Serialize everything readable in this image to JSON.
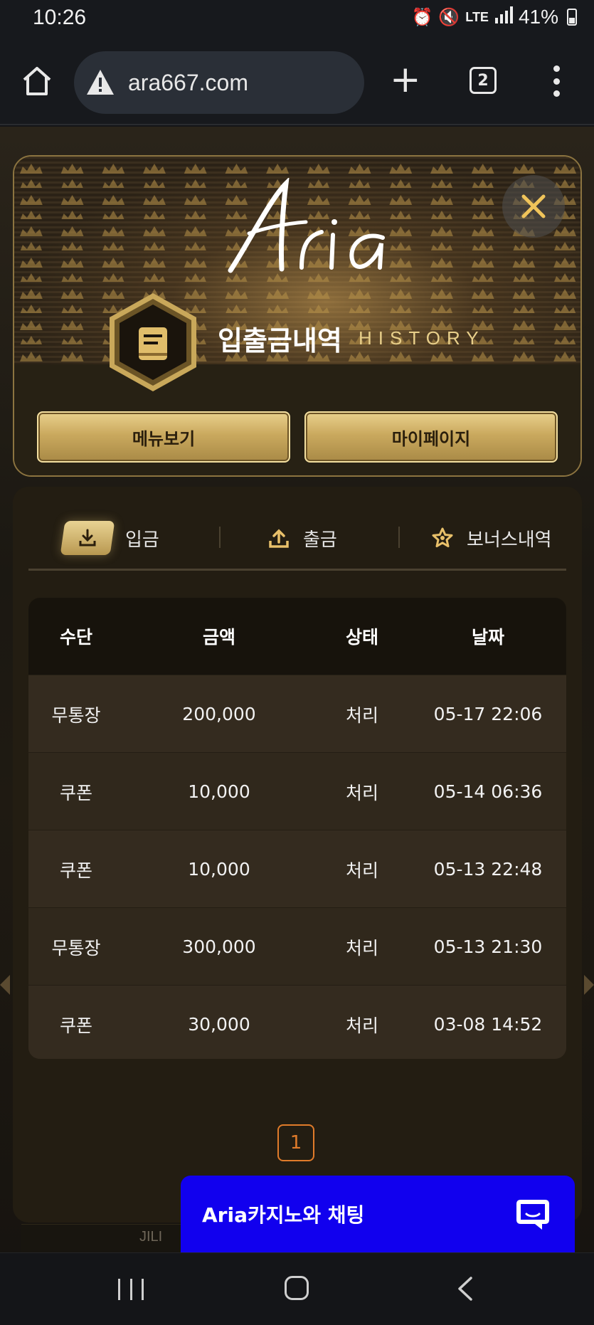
{
  "status_bar": {
    "time": "10:26",
    "battery": "41%",
    "network": "LTE"
  },
  "browser": {
    "url": "ara667.com",
    "tab_count": "2"
  },
  "modal": {
    "logo_text": "Aria",
    "title_ko": "입출금내역",
    "title_en": "HISTORY",
    "buttons": {
      "menu": "메뉴보기",
      "mypage": "마이페이지"
    }
  },
  "tabs": [
    {
      "label": "입금",
      "icon": "download-icon",
      "active": true
    },
    {
      "label": "출금",
      "icon": "upload-icon",
      "active": false
    },
    {
      "label": "보너스내역",
      "icon": "star-icon",
      "active": false
    }
  ],
  "table": {
    "headers": [
      "수단",
      "금액",
      "상태",
      "날짜"
    ],
    "rows": [
      [
        "무통장",
        "200,000",
        "처리",
        "05-17 22:06"
      ],
      [
        "쿠폰",
        "10,000",
        "처리",
        "05-14 06:36"
      ],
      [
        "쿠폰",
        "10,000",
        "처리",
        "05-13 22:48"
      ],
      [
        "무통장",
        "300,000",
        "처리",
        "05-13 21:30"
      ],
      [
        "쿠폰",
        "30,000",
        "처리",
        "03-08 14:52"
      ]
    ]
  },
  "pagination": {
    "current": "1"
  },
  "footer_peek": {
    "text": "JILI"
  },
  "chat": {
    "label": "Aria카지노와 채팅"
  },
  "colors": {
    "gold": "#caa95e",
    "accent_orange": "#e07b2a",
    "chat_blue": "#1100ee"
  }
}
